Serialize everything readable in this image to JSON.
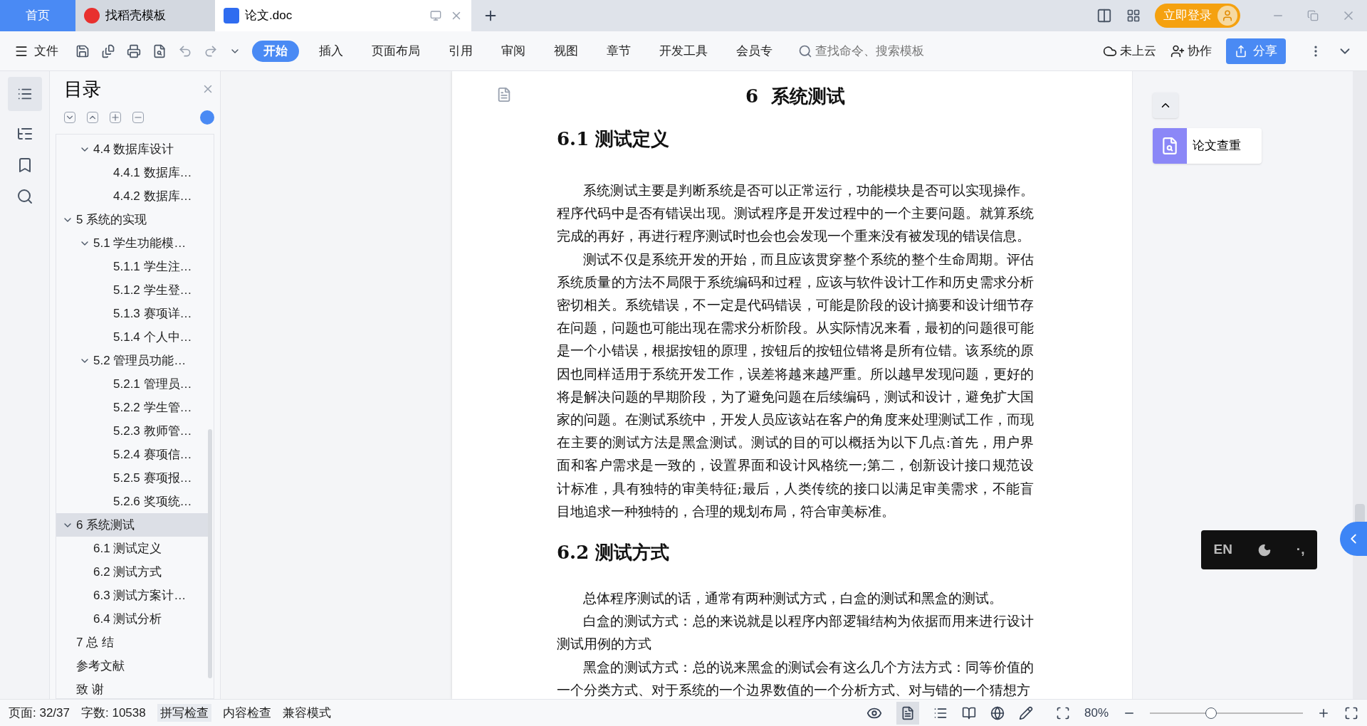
{
  "tabs": [
    {
      "label": "首页",
      "kind": "home",
      "selected": false
    },
    {
      "label": "找稻壳模板",
      "kind": "template",
      "selected": false
    },
    {
      "label": "论文.doc",
      "kind": "doc",
      "selected": true
    }
  ],
  "account": {
    "login": "立即登录"
  },
  "menu": {
    "file": "文件",
    "tabs": [
      {
        "label": "开始",
        "selected": true
      },
      {
        "label": "插入",
        "selected": false
      },
      {
        "label": "页面布局",
        "selected": false
      },
      {
        "label": "引用",
        "selected": false
      },
      {
        "label": "审阅",
        "selected": false
      },
      {
        "label": "视图",
        "selected": false
      },
      {
        "label": "章节",
        "selected": false
      },
      {
        "label": "开发工具",
        "selected": false
      },
      {
        "label": "会员专",
        "selected": false
      }
    ],
    "search": {
      "placeholder": "查找命令、搜索模板"
    },
    "cloud": "未上云",
    "collab": "协作",
    "share": "分享"
  },
  "toc": {
    "title": "目录",
    "continued": [
      {
        "label": "4.4 数据库设计",
        "expanded": true,
        "children": [
          {
            "label": "4.4.1  数据库…"
          },
          {
            "label": "4.4.2  数据库…"
          }
        ]
      }
    ],
    "items": [
      {
        "label": "5  系统的实现",
        "expanded": true,
        "selected": false,
        "children": [
          {
            "label": "5.1 学生功能模…",
            "expanded": true,
            "children": [
              {
                "label": "5.1.1  学生注…"
              },
              {
                "label": "5.1.2  学生登…"
              },
              {
                "label": "5.1.3  赛项详…"
              },
              {
                "label": "5.1.4  个人中…"
              }
            ]
          },
          {
            "label": "5.2 管理员功能…",
            "expanded": true,
            "children": [
              {
                "label": "5.2.1  管理员…"
              },
              {
                "label": "5.2.2  学生管…"
              },
              {
                "label": "5.2.3  教师管…"
              },
              {
                "label": "5.2.4  赛项信…"
              },
              {
                "label": "5.2.5  赛项报…"
              },
              {
                "label": "5.2.6  奖项统…"
              }
            ]
          }
        ]
      },
      {
        "label": "6  系统测试",
        "expanded": true,
        "selected": true,
        "children": [
          {
            "label": "6.1 测试定义"
          },
          {
            "label": "6.2 测试方式"
          },
          {
            "label": "6.3 测试方案计…"
          },
          {
            "label": "6.4 测试分析"
          }
        ]
      },
      {
        "label": "7  总  结",
        "selected": false
      },
      {
        "label": "参考文献",
        "selected": false
      },
      {
        "label": "致  谢",
        "selected": false
      }
    ]
  },
  "document": {
    "chapter": "6  系统测试",
    "sections": [
      {
        "heading": "6.1 测试定义",
        "paragraphs": [
          "系统测试主要是判断系统是否可以正常运行，功能模块是否可以实现操作。程序代码中是否有错误出现。测试程序是开发过程中的一个主要问题。就算系统完成的再好，再进行程序测试时也会也会发现一个重来没有被发现的错误信息。",
          "测试不仅是系统开发的开始，而且应该贯穿整个系统的整个生命周期。评估系统质量的方法不局限于系统编码和过程，应该与软件设计工作和历史需求分析密切相关。系统错误，不一定是代码错误，可能是阶段的设计摘要和设计细节存在问题，问题也可能出现在需求分析阶段。从实际情况来看，最初的问题很可能是一个小错误，根据按钮的原理，按钮后的按钮位错将是所有位错。该系统的原因也同样适用于系统开发工作，误差将越来越严重。所以越早发现问题，更好的将是解决问题的早期阶段，为了避免问题在后续编码，测试和设计，避免扩大国家的问题。在测试系统中，开发人员应该站在客户的角度来处理测试工作，而现在主要的测试方法是黑盒测试。测试的目的可以概括为以下几点:首先，用户界面和客户需求是一致的，设置界面和设计风格统一;第二，创新设计接口规范设计标准，具有独特的审美特征;最后，人类传统的接口以满足审美需求，不能盲目地追求一种独特的，合理的规划布局，符合审美标准。"
        ]
      },
      {
        "heading": "6.2 测试方式",
        "paragraphs": [
          "总体程序测试的话，通常有两种测试方式，白盒的测试和黑盒的测试。",
          "白盒的测试方式：总的来说就是以程序内部逻辑结构为依据而用来进行设计测试用例的方式",
          "黑盒的测试方式：总的说来黑盒的测试会有这么几个方法方式：同等价值的一个分类方式、对于系统的一个边界数值的一个分析方式、对与错的一个猜想方"
        ]
      }
    ]
  },
  "side_panel": {
    "plagiarism": "论文查重"
  },
  "ime": {
    "lang": "EN",
    "punct": "·,"
  },
  "status_bar": {
    "page": "页面: 32/37",
    "words": "字数: 10538",
    "spell": "拼写检查",
    "content": "内容检查",
    "compat": "兼容模式",
    "zoom": "80%",
    "zoom_slider": {
      "level": 0.4
    }
  }
}
